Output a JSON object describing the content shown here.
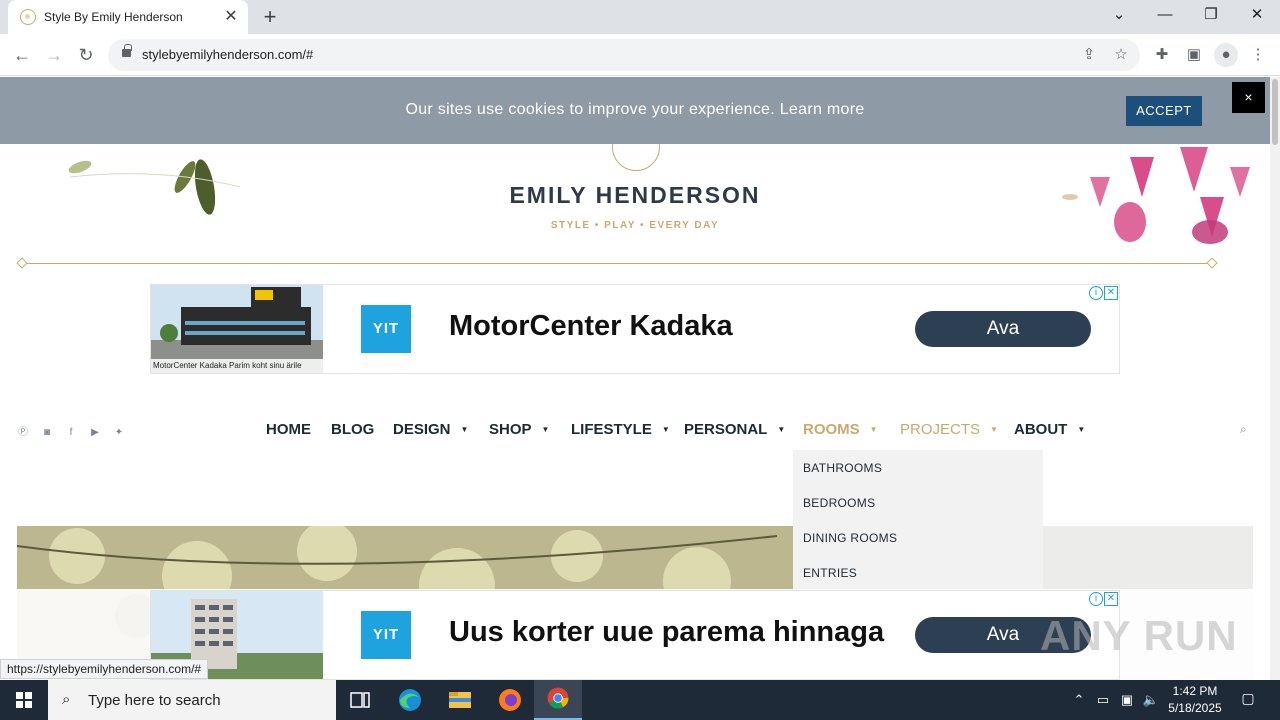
{
  "browser": {
    "tab_title": "Style By Emily Henderson",
    "url": "stylebyemilyhenderson.com/#"
  },
  "cookie_banner": {
    "text": "Our sites use cookies to improve your experience. Learn more",
    "accept_label": "ACCEPT",
    "close_label": "×"
  },
  "site": {
    "brand": "EMILY HENDERSON",
    "tagline": "STYLE   •   PLAY   •   EVERY DAY"
  },
  "ads": {
    "top": {
      "logo": "YIT",
      "headline": "MotorCenter Kadaka",
      "cta": "Ava",
      "image_caption": "MotorCenter Kadaka Parim koht sinu ärile"
    },
    "bottom": {
      "logo": "YIT",
      "headline": "Uus korter uue parema hinnaga",
      "cta": "Ava"
    }
  },
  "nav": {
    "items": [
      {
        "label": "HOME"
      },
      {
        "label": "BLOG"
      },
      {
        "label": "DESIGN"
      },
      {
        "label": "SHOP"
      },
      {
        "label": "LIFESTYLE"
      },
      {
        "label": "PERSONAL"
      },
      {
        "label": "ROOMS"
      },
      {
        "label": "PROJECTS"
      },
      {
        "label": "ABOUT"
      }
    ],
    "social_icons": [
      "pinterest-icon",
      "instagram-icon",
      "facebook-icon",
      "youtube-icon",
      "twitter-icon"
    ]
  },
  "rooms_dropdown": {
    "items": [
      "BATHROOMS",
      "BEDROOMS",
      "DINING ROOMS",
      "ENTRIES"
    ]
  },
  "status_url": "https://stylebyemilyhenderson.com/#",
  "watermark": "ANY RUN",
  "taskbar": {
    "search_placeholder": "Type here to search",
    "time": "1:42 PM",
    "date": "5/18/2025"
  },
  "colors": {
    "gold": "#c9a96e",
    "brand_text": "#2f3a46",
    "cookie_bg": "#8e9aa5",
    "accept_bg": "#1d4f7c",
    "yit_blue": "#1fa3de",
    "cta_bg": "#2d3f52"
  }
}
